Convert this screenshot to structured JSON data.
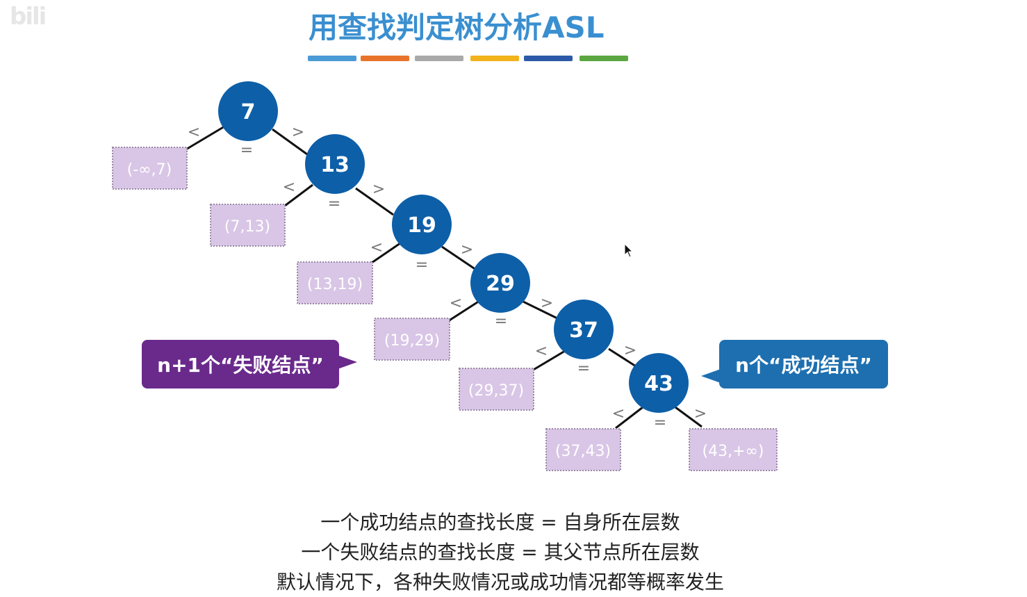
{
  "watermark": "bili",
  "title": "用查找判定树分析ASL",
  "title_color": "#3a8fd0",
  "color_bar": [
    "#4a9ad6",
    "#e8742b",
    "#a9a9a9",
    "#f2b21a",
    "#2d5aa8",
    "#5aa640"
  ],
  "node_color": "#0d5fa8",
  "fail_box_color": "#d9c6e6",
  "nodes": [
    "7",
    "13",
    "19",
    "29",
    "37",
    "43"
  ],
  "fail_nodes": [
    "(-∞,7)",
    "(7,13)",
    "(13,19)",
    "(19,29)",
    "(29,37)",
    "(37,43)",
    "(43,+∞)"
  ],
  "edge_labels": {
    "less": "<",
    "greater": ">",
    "equal": "="
  },
  "callouts": {
    "fail": "n+1个“失败结点”",
    "success": "n个“成功结点”"
  },
  "notes": [
    "一个成功结点的查找长度 = 自身所在层数",
    "一个失败结点的查找长度 = 其父节点所在层数",
    "默认情况下，各种失败情况或成功情况都等概率发生"
  ]
}
